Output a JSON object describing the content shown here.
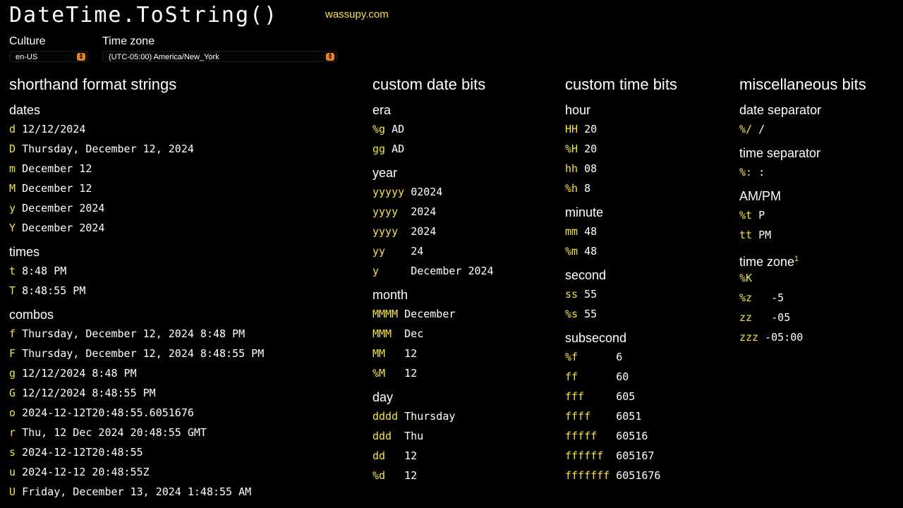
{
  "header": {
    "title": "DateTime.ToString()",
    "site": "wassupy.com"
  },
  "controls": {
    "culture_label": "Culture",
    "culture_value": "en-US",
    "timezone_label": "Time zone",
    "timezone_value": "(UTC-05:00) America/New_York"
  },
  "accent_color": "#f5e24a",
  "select_arrow_color": "#e8841a",
  "columns": [
    {
      "title": "shorthand format strings",
      "groups": [
        {
          "heading": "dates",
          "rows": [
            {
              "spec": "d",
              "value": "12/12/2024"
            },
            {
              "spec": "D",
              "value": "Thursday, December 12, 2024"
            },
            {
              "spec": "m",
              "value": "December 12"
            },
            {
              "spec": "M",
              "value": "December 12"
            },
            {
              "spec": "y",
              "value": "December 2024"
            },
            {
              "spec": "Y",
              "value": "December 2024"
            }
          ]
        },
        {
          "heading": "times",
          "rows": [
            {
              "spec": "t",
              "value": "8:48 PM"
            },
            {
              "spec": "T",
              "value": "8:48:55 PM"
            }
          ]
        },
        {
          "heading": "combos",
          "rows": [
            {
              "spec": "f",
              "value": "Thursday, December 12, 2024 8:48 PM"
            },
            {
              "spec": "F",
              "value": "Thursday, December 12, 2024 8:48:55 PM"
            },
            {
              "spec": "g",
              "value": "12/12/2024 8:48 PM"
            },
            {
              "spec": "G",
              "value": "12/12/2024 8:48:55 PM"
            },
            {
              "spec": "o",
              "value": "2024-12-12T20:48:55.6051676"
            },
            {
              "spec": "r",
              "value": "Thu, 12 Dec 2024 20:48:55 GMT"
            },
            {
              "spec": "s",
              "value": "2024-12-12T20:48:55"
            },
            {
              "spec": "u",
              "value": "2024-12-12 20:48:55Z"
            },
            {
              "spec": "U",
              "value": "Friday, December 13, 2024 1:48:55 AM"
            }
          ]
        }
      ]
    },
    {
      "title": "custom date bits",
      "groups": [
        {
          "heading": "era",
          "rows": [
            {
              "spec": "%g",
              "value": "AD"
            },
            {
              "spec": "gg",
              "value": "AD"
            }
          ]
        },
        {
          "heading": "year",
          "rows": [
            {
              "spec": "yyyyy",
              "value": "02024"
            },
            {
              "spec": "yyyy ",
              "value": "2024"
            },
            {
              "spec": "yyyy ",
              "value": "2024"
            },
            {
              "spec": "yy   ",
              "value": "24"
            },
            {
              "spec": "y    ",
              "value": "December 2024"
            }
          ]
        },
        {
          "heading": "month",
          "rows": [
            {
              "spec": "MMMM",
              "value": "December"
            },
            {
              "spec": "MMM ",
              "value": "Dec"
            },
            {
              "spec": "MM  ",
              "value": "12"
            },
            {
              "spec": "%M  ",
              "value": "12"
            }
          ]
        },
        {
          "heading": "day",
          "rows": [
            {
              "spec": "dddd",
              "value": "Thursday"
            },
            {
              "spec": "ddd ",
              "value": "Thu"
            },
            {
              "spec": "dd  ",
              "value": "12"
            },
            {
              "spec": "%d  ",
              "value": "12"
            }
          ]
        }
      ]
    },
    {
      "title": "custom time bits",
      "groups": [
        {
          "heading": "hour",
          "rows": [
            {
              "spec": "HH",
              "value": "20"
            },
            {
              "spec": "%H",
              "value": "20"
            },
            {
              "spec": "hh",
              "value": "08"
            },
            {
              "spec": "%h",
              "value": "8"
            }
          ]
        },
        {
          "heading": "minute",
          "rows": [
            {
              "spec": "mm",
              "value": "48"
            },
            {
              "spec": "%m",
              "value": "48"
            }
          ]
        },
        {
          "heading": "second",
          "rows": [
            {
              "spec": "ss",
              "value": "55"
            },
            {
              "spec": "%s",
              "value": "55"
            }
          ]
        },
        {
          "heading": "subsecond",
          "rows": [
            {
              "spec": "%f     ",
              "value": "6"
            },
            {
              "spec": "ff     ",
              "value": "60"
            },
            {
              "spec": "fff    ",
              "value": "605"
            },
            {
              "spec": "ffff   ",
              "value": "6051"
            },
            {
              "spec": "fffff  ",
              "value": "60516"
            },
            {
              "spec": "ffffff ",
              "value": "605167"
            },
            {
              "spec": "fffffff",
              "value": "6051676"
            }
          ]
        }
      ]
    },
    {
      "title": "miscellaneous bits",
      "groups": [
        {
          "heading": "date separator",
          "rows": [
            {
              "spec": "%/",
              "value": "/"
            }
          ]
        },
        {
          "heading": "time separator",
          "rows": [
            {
              "spec": "%:",
              "value": ":"
            }
          ]
        },
        {
          "heading": "AM/PM",
          "rows": [
            {
              "spec": "%t",
              "value": "P"
            },
            {
              "spec": "tt",
              "value": "PM"
            }
          ]
        },
        {
          "heading": "time zone",
          "footnote": "1",
          "rows": [
            {
              "spec": "%K ",
              "value": ""
            },
            {
              "spec": "%z ",
              "value": " -5"
            },
            {
              "spec": "zz ",
              "value": " -05"
            },
            {
              "spec": "zzz",
              "value": "-05:00"
            }
          ]
        }
      ]
    }
  ]
}
